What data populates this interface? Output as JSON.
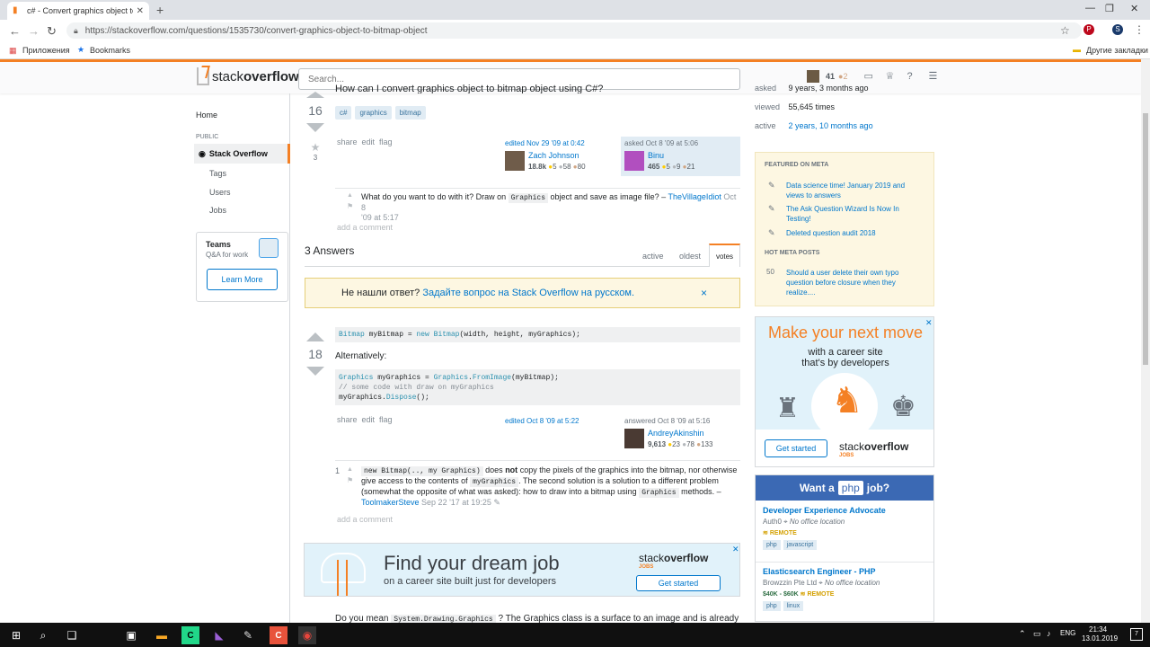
{
  "browser": {
    "tab_title": "c# - Convert graphics object to bi",
    "url": "https://stackoverflow.com/questions/1535730/convert-graphics-object-to-bitmap-object",
    "bookmarks": [
      "Приложения",
      "Bookmarks"
    ],
    "other_bookmarks": "Другие закладки"
  },
  "header": {
    "logo_a": "stack",
    "logo_b": "overflow",
    "search_placeholder": "Search...",
    "rep": "41",
    "badges": "●2"
  },
  "leftnav": {
    "home": "Home",
    "public": "PUBLIC",
    "stack_overflow": "Stack Overflow",
    "tags": "Tags",
    "users": "Users",
    "jobs": "Jobs",
    "teams_title": "Teams",
    "teams_sub": "Q&A for work",
    "learn_more": "Learn More"
  },
  "question": {
    "title_text": "How can I convert graphics object to bitmap object using C#?",
    "votes": "16",
    "favs": "3",
    "tags": [
      "c#",
      "graphics",
      "bitmap"
    ],
    "menu": [
      "share",
      "edit",
      "flag"
    ],
    "edited": "edited Nov 29 '09 at 0:42",
    "editor": "Zach Johnson",
    "editor_rep": "18.8k",
    "editor_g": "5",
    "editor_s": "58",
    "editor_b": "80",
    "asked": "asked Oct 8 '09 at 5:06",
    "asker": "Binu",
    "asker_rep": "465",
    "asker_g": "5",
    "asker_s": "9",
    "asker_b": "21",
    "comment_a": "What do you want to do with it? Draw on",
    "comment_code": "Graphics",
    "comment_b": "object and save as image file? –",
    "comment_user": "TheVillageIdiot",
    "comment_date1": "Oct 8",
    "comment_date2": "'09 at 5:17",
    "add_comment": "add a comment"
  },
  "answers": {
    "count": "3 Answers",
    "tabs": [
      "active",
      "oldest",
      "votes"
    ],
    "notice_a": "Не нашли ответ?",
    "notice_link": "Задайте вопрос на Stack Overflow на русском.",
    "notice_close": "×"
  },
  "answer1": {
    "votes": "18",
    "code1_a": "Bitmap",
    "code1_b": " myBitmap = ",
    "code1_c": "new",
    "code1_d": " ",
    "code1_e": "Bitmap",
    "code1_f": "(width, height, myGraphics);",
    "alt": "Alternatively:",
    "code2_l1a": "Graphics",
    "code2_l1b": " myGraphics = ",
    "code2_l1c": "Graphics",
    "code2_l1d": ".",
    "code2_l1e": "FromImage",
    "code2_l1f": "(myBitmap);",
    "code2_l2": "// some code with draw on myGraphics",
    "code2_l3a": "myGraphics.",
    "code2_l3b": "Dispose",
    "code2_l3c": "();",
    "menu": [
      "share",
      "edit",
      "flag"
    ],
    "edited": "edited Oct 8 '09 at 5:22",
    "answered": "answered Oct 8 '09 at 5:16",
    "user": "AndreyAkinshin",
    "rep": "9,613",
    "g": "23",
    "s": "78",
    "b": "133",
    "c_votes": "1",
    "c_code1": "new Bitmap(.., my Graphics)",
    "c_t1": "does",
    "c_not": "not",
    "c_t2": "copy the pixels of the graphics into the bitmap, nor otherwise",
    "c_t3": "give access to the contents of",
    "c_code2": "myGraphics",
    "c_t4": ". The second solution is a solution to a different problem",
    "c_t5": "(somewhat the opposite of what was asked): how to draw into a bitmap using",
    "c_code3": "Graphics",
    "c_t6": "methods. –",
    "c_user": "ToolmakerSteve",
    "c_date": "Sep 22 '17 at 19:25",
    "c_edit": "✎",
    "add_comment": "add a comment"
  },
  "dreamad": {
    "head": "Find your dream job",
    "sub": "on a career site built just for developers",
    "logo_a": "stack",
    "logo_b": "overflow",
    "jobs": "JOBS",
    "btn": "Get started",
    "close": "✕"
  },
  "answer2_partial": {
    "t1": "Do you mean",
    "code": "System.Drawing.Graphics",
    "t2": "? The Graphics class is a surface to an image and is already"
  },
  "sidebar": {
    "asked_k": "asked",
    "asked_v": "9 years, 3 months ago",
    "viewed_k": "viewed",
    "viewed_v": "55,645 times",
    "active_k": "active",
    "active_v": "2 years, 10 months ago",
    "featured": "FEATURED ON META",
    "meta1": "Data science time! January 2019 and views to answers",
    "meta2": "The Ask Question Wizard Is Now In Testing!",
    "meta3": "Deleted question audit 2018",
    "hot": "HOT META POSTS",
    "hot_count": "50",
    "hot1": "Should a user delete their own typo question before closure when they realize...."
  },
  "ad1": {
    "head": "Make your next move",
    "sub1": "with a career site",
    "sub2": "that's by developers",
    "btn": "Get started",
    "logo_a": "stack",
    "logo_b": "overflow",
    "jobs": "JOBS",
    "close": "✕"
  },
  "ad2": {
    "want": "Want a",
    "php": "php",
    "job": "job?",
    "job1_title": "Developer Experience Advocate",
    "job1_company": "Auth0",
    "job1_loc": "No office location",
    "job1_remote": "REMOTE",
    "job1_tags": [
      "php",
      "javascript"
    ],
    "job2_title": "Elasticsearch Engineer - PHP",
    "job2_company": "Browzzin Pte Ltd",
    "job2_loc": "No office location",
    "job2_salary": "$40K - $60K",
    "job2_remote": "REMOTE",
    "job2_tags": [
      "php",
      "linux"
    ]
  },
  "taskbar": {
    "lang": "ENG",
    "time": "21:34",
    "date": "13.01.2019",
    "notif": "7"
  }
}
